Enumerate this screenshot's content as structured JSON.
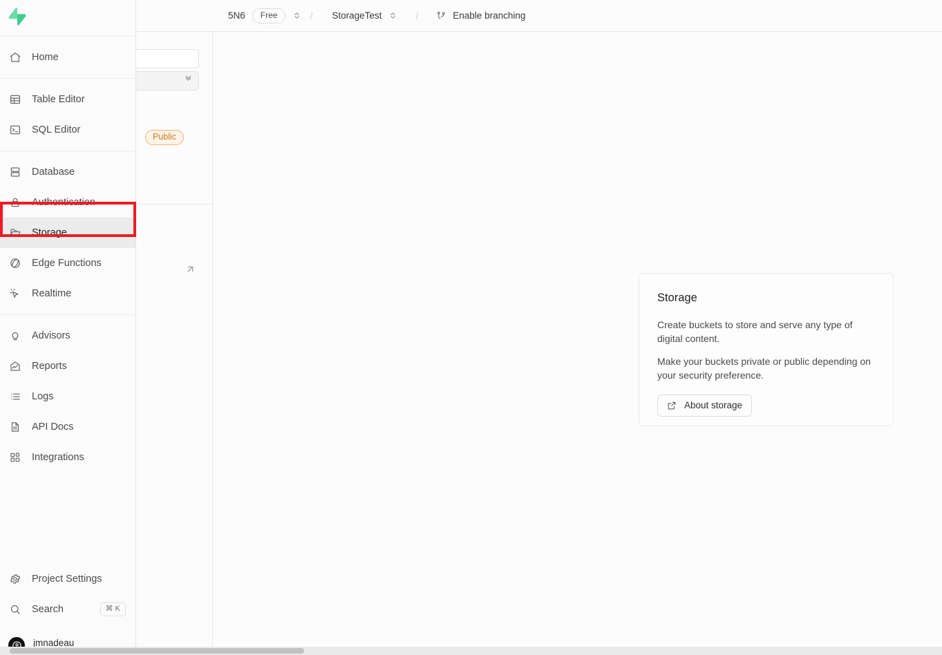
{
  "app": {
    "logo_icon": "supabase-bolt-logo"
  },
  "topbar": {
    "org": "5N6",
    "plan_badge": "Free",
    "separator": "/",
    "project": "StorageTest",
    "branching_label": "Enable branching",
    "branch_icon": "git-branch-icon",
    "chevron_icon": "chevron-up-down-icon"
  },
  "sidebar": {
    "groups": [
      {
        "items": [
          {
            "label": "Home",
            "icon": "home-icon",
            "active": false
          }
        ]
      },
      {
        "items": [
          {
            "label": "Table Editor",
            "icon": "table-icon",
            "active": false
          },
          {
            "label": "SQL Editor",
            "icon": "terminal-icon",
            "active": false
          }
        ]
      },
      {
        "items": [
          {
            "label": "Database",
            "icon": "database-icon",
            "active": false
          },
          {
            "label": "Authentication",
            "icon": "lock-icon",
            "active": false
          },
          {
            "label": "Storage",
            "icon": "folder-icon",
            "active": true
          },
          {
            "label": "Edge Functions",
            "icon": "function-icon",
            "active": false
          },
          {
            "label": "Realtime",
            "icon": "cursor-sparkle-icon",
            "active": false
          }
        ]
      },
      {
        "items": [
          {
            "label": "Advisors",
            "icon": "lightbulb-icon",
            "active": false
          },
          {
            "label": "Reports",
            "icon": "chart-icon",
            "active": false
          },
          {
            "label": "Logs",
            "icon": "list-icon",
            "active": false
          },
          {
            "label": "API Docs",
            "icon": "document-icon",
            "active": false
          },
          {
            "label": "Integrations",
            "icon": "grid-plus-icon",
            "active": false
          }
        ]
      }
    ],
    "bottom": {
      "settings_label": "Project Settings",
      "settings_icon": "gear-icon",
      "search_label": "Search",
      "search_icon": "search-icon",
      "search_shortcut": "⌘ K",
      "user_name": "jmnadeau",
      "avatar_icon": "user-avatar-icon"
    }
  },
  "hidden_panel": {
    "input_value": "",
    "select_value": "",
    "badge_label": "Public",
    "external_link_icon": "arrow-up-right-icon",
    "chevron_icon": "chevron-up-down-icon"
  },
  "storage_card": {
    "title": "Storage",
    "paragraph_1": "Create buckets to store and serve any type of digital content.",
    "paragraph_2": "Make your buckets private or public depending on your security preference.",
    "button_label": "About storage",
    "button_icon": "external-link-icon"
  },
  "colors": {
    "brand_green": "#3ecf8e",
    "highlight_red": "#ed1c24",
    "badge_orange_text": "#cd7c21",
    "badge_orange_bg": "#fdf3e7",
    "active_bg": "#ececec"
  }
}
